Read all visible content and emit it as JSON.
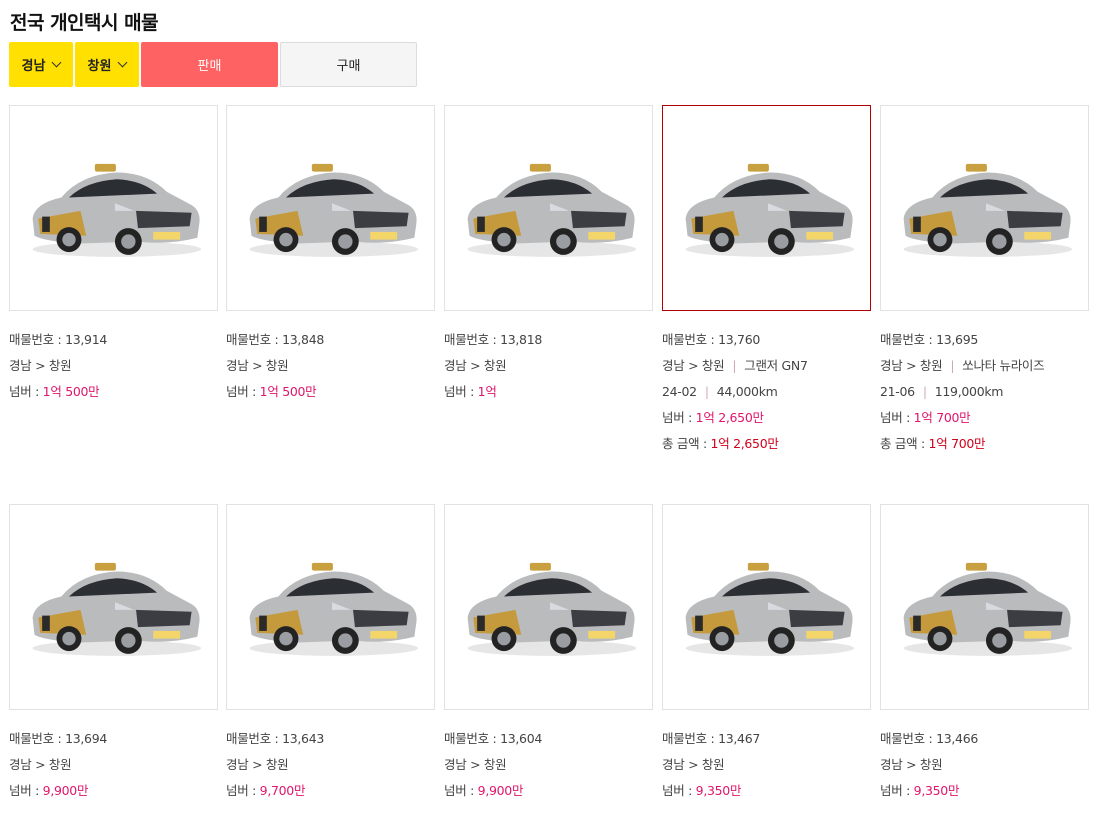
{
  "title": "전국 개인택시 매물",
  "filters": {
    "region": "경남",
    "city": "창원",
    "sell": "판매",
    "buy": "구매"
  },
  "labels": {
    "id": "매물번호 : ",
    "price": "넘버 : ",
    "total": "총 금액 : "
  },
  "colors": {
    "accent_yellow": "#ffe000",
    "sell_red": "#ff6262",
    "price_pink": "#e0166b",
    "total_red": "#d0021b",
    "active_border": "#b40000"
  },
  "listings": [
    {
      "id": "13,914",
      "region": "경남 > 창원",
      "price": "1억 500만"
    },
    {
      "id": "13,848",
      "region": "경남 > 창원",
      "price": "1억 500만"
    },
    {
      "id": "13,818",
      "region": "경남 > 창원",
      "price": "1억"
    },
    {
      "id": "13,760",
      "region": "경남 > 창원",
      "model": "그랜저 GN7",
      "year": "24-02",
      "mileage": "44,000km",
      "price": "1억 2,650만",
      "total": "1억 2,650만",
      "active": true
    },
    {
      "id": "13,695",
      "region": "경남 > 창원",
      "model": "쏘나타 뉴라이즈",
      "year": "21-06",
      "mileage": "119,000km",
      "price": "1억 700만",
      "total": "1억 700만"
    },
    {
      "id": "13,694",
      "region": "경남 > 창원",
      "price": "9,900만"
    },
    {
      "id": "13,643",
      "region": "경남 > 창원",
      "price": "9,700만"
    },
    {
      "id": "13,604",
      "region": "경남 > 창원",
      "price": "9,900만"
    },
    {
      "id": "13,467",
      "region": "경남 > 창원",
      "price": "9,350만"
    },
    {
      "id": "13,466",
      "region": "경남 > 창원",
      "price": "9,350만"
    }
  ]
}
